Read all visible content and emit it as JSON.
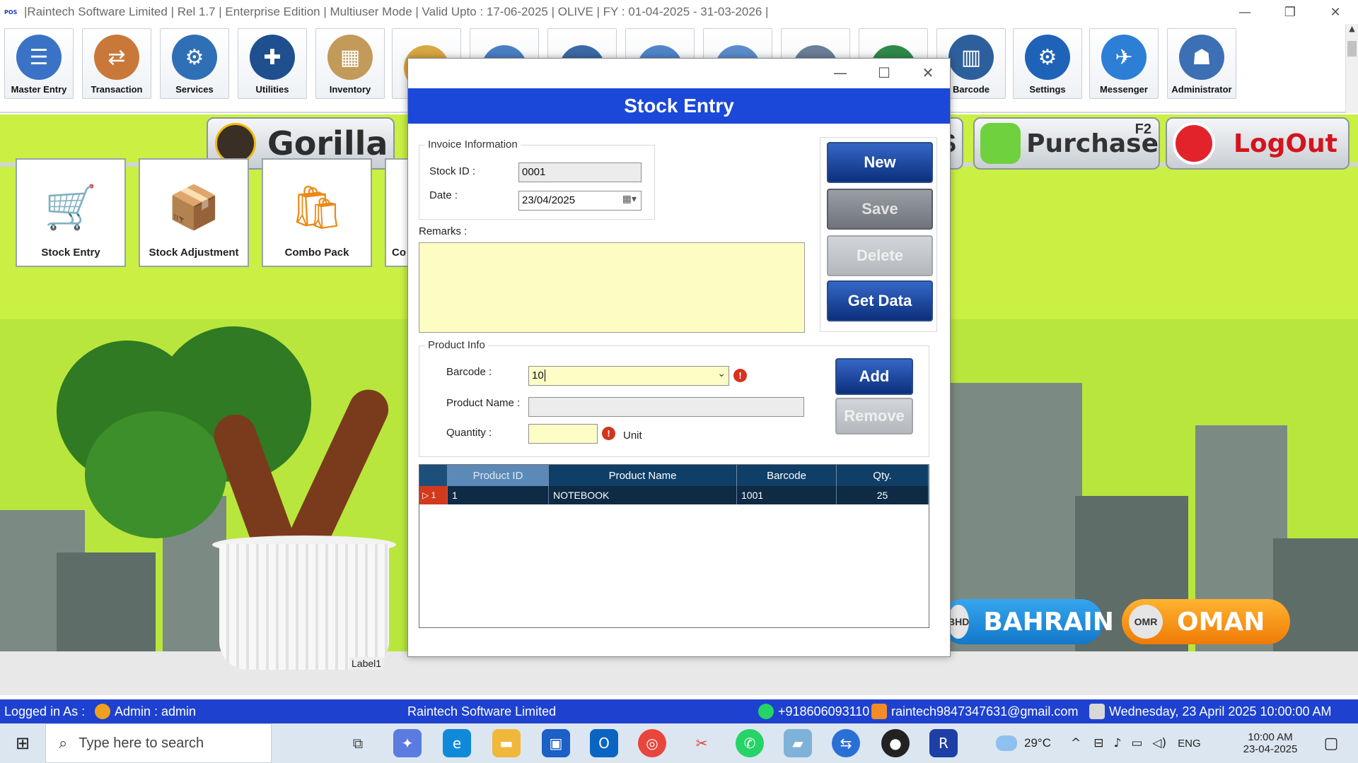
{
  "window": {
    "title": "|Raintech Software Limited |  Rel 1.7  |  Enterprise Edition  |  Multiuser Mode  |  Valid Upto : 17-06-2025  |  OLIVE  |  FY : 01-04-2025  -  31-03-2026  |",
    "logo_text": "POS",
    "minimize": "—",
    "restore": "❐",
    "close": "✕"
  },
  "toolbar": {
    "items": [
      {
        "label": "Master Entry",
        "icon": "master-entry-icon",
        "color": "#3a73c6"
      },
      {
        "label": "Transaction",
        "icon": "transaction-icon",
        "color": "#c9783a"
      },
      {
        "label": "Services",
        "icon": "services-icon",
        "color": "#2f6fb6"
      },
      {
        "label": "Utilities",
        "icon": "utilities-icon",
        "color": "#1f4f8f"
      },
      {
        "label": "Inventory",
        "icon": "inventory-icon",
        "color": "#c29a5a"
      },
      {
        "label": "",
        "icon": "reports-icon",
        "color": "#d9a642"
      },
      {
        "label": "",
        "icon": "documents-icon",
        "color": "#4a7fc4"
      },
      {
        "label": "",
        "icon": "accounts-icon",
        "color": "#3b6aa6"
      },
      {
        "label": "",
        "icon": "analytics-icon",
        "color": "#4f86c9"
      },
      {
        "label": "",
        "icon": "tools-icon",
        "color": "#5a8ccc"
      },
      {
        "label": "",
        "icon": "database-icon",
        "color": "#6a7f98"
      },
      {
        "label": "",
        "icon": "export-icon",
        "color": "#2f8a4a"
      },
      {
        "label": "Barcode",
        "icon": "barcode-scanner-icon",
        "color": "#2d5f9c"
      },
      {
        "label": "Settings",
        "icon": "settings-gear-icon",
        "color": "#1f63b8"
      },
      {
        "label": "Messenger",
        "icon": "messenger-icon",
        "color": "#2d7fd6"
      },
      {
        "label": "Administrator",
        "icon": "administrator-icon",
        "color": "#3c6fb4"
      }
    ]
  },
  "desktop": {
    "gorilla_label": "Gorilla",
    "purchase_label": "Purchase",
    "purchase_shortcut": "F2",
    "logout_label": "LogOut",
    "s_fragment": "S",
    "modules": [
      {
        "label": "Stock Entry",
        "glyph": "🛒"
      },
      {
        "label": "Stock Adjustment",
        "glyph": "📦"
      },
      {
        "label": "Combo Pack",
        "glyph": "🛍"
      },
      {
        "label": "Co",
        "glyph": ""
      }
    ],
    "label1": "Label1",
    "bahrain": {
      "currency": "BHD",
      "name": "BAHRAIN"
    },
    "oman": {
      "currency": "OMR",
      "name": "OMAN"
    }
  },
  "dialog": {
    "title": "Stock Entry",
    "invoice_group": "Invoice Information",
    "stock_id_label": "Stock ID :",
    "stock_id_value": "0001",
    "date_label": "Date :",
    "date_value": "23/04/2025",
    "remarks_label": "Remarks :",
    "product_group": "Product Info",
    "barcode_label": "Barcode :",
    "barcode_value": "10",
    "product_name_label": "Product Name :",
    "product_name_value": "",
    "quantity_label": "Quantity :",
    "quantity_value": "",
    "unit_label": "Unit",
    "buttons": {
      "new": "New",
      "save": "Save",
      "delete": "Delete",
      "get_data": "Get Data",
      "add": "Add",
      "remove": "Remove"
    },
    "grid": {
      "columns": [
        "Product ID",
        "Product Name",
        "Barcode",
        "Qty."
      ],
      "rows": [
        {
          "row_no": "1",
          "product_id": "1",
          "product_name": "NOTEBOOK",
          "barcode": "1001",
          "qty": "25"
        }
      ]
    }
  },
  "statusbar": {
    "logged_in": "Logged in As :",
    "user": "Admin  :  admin",
    "company": "Raintech Software Limited",
    "phone": "+918606093110",
    "email": "raintech9847347631@gmail.com",
    "datetime": "Wednesday, 23 April 2025 10:00:00 AM"
  },
  "taskbar": {
    "search_placeholder": "Type here to search",
    "weather": "29°C",
    "language": "ENG",
    "time": "10:00 AM",
    "date": "23-04-2025"
  }
}
